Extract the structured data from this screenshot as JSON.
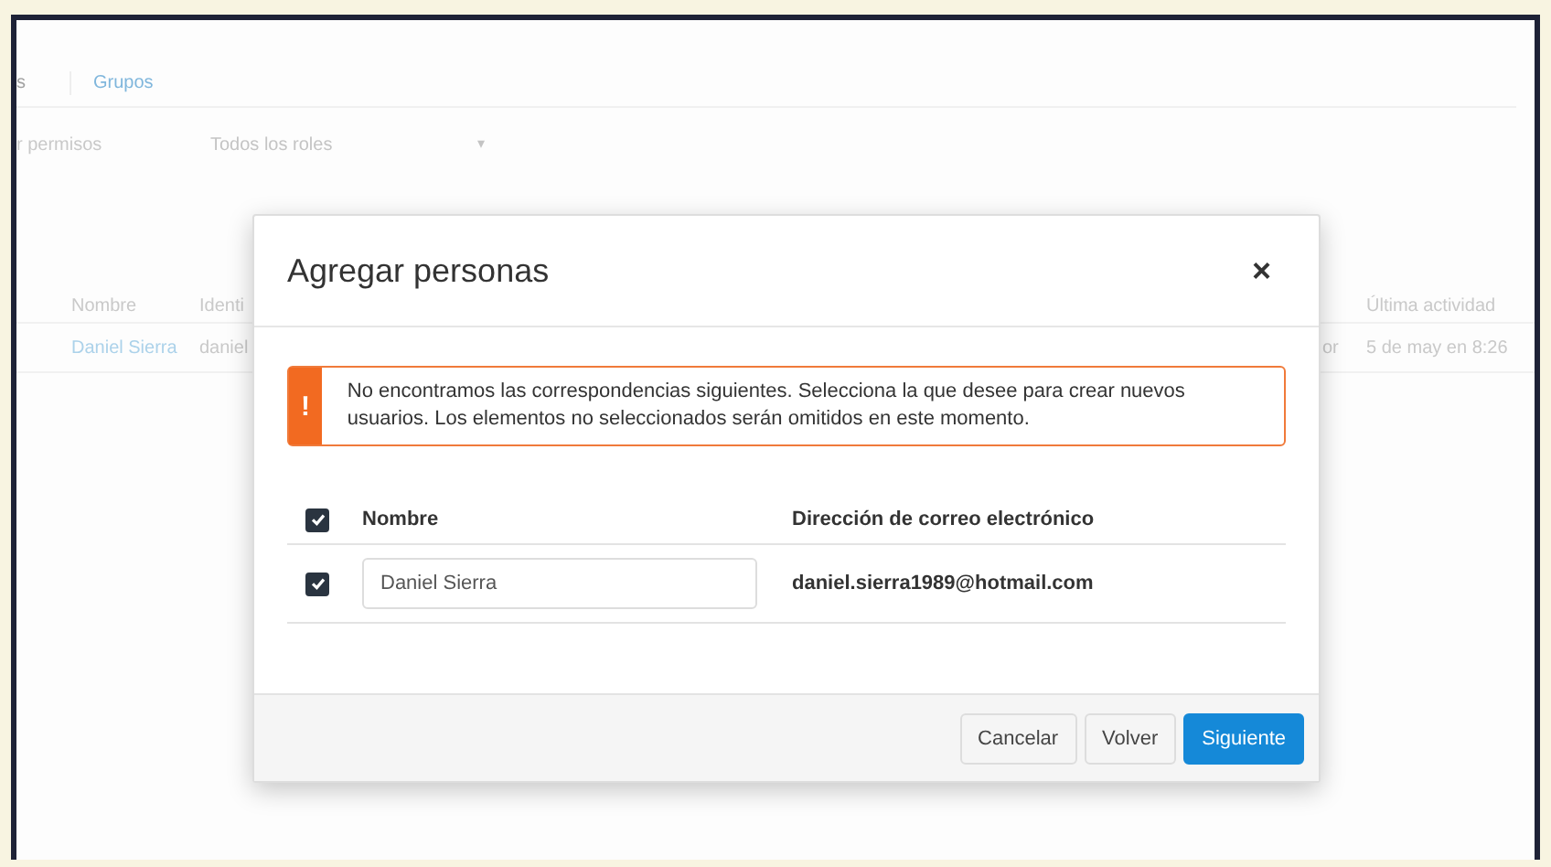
{
  "background": {
    "tabs": [
      {
        "label": "s",
        "selected": false
      },
      {
        "label": "Grupos",
        "selected": true
      }
    ],
    "filter_label": "r permisos",
    "role_dropdown": {
      "value": "Todos los roles",
      "caret": "▾"
    },
    "table": {
      "columns": [
        "Nombre",
        "Identi",
        "Última actividad"
      ],
      "rows": [
        {
          "name": "Daniel Sierra",
          "column_2": "daniel",
          "column_3": "or",
          "last_activity": "5 de may en 8:26"
        }
      ]
    }
  },
  "dialog": {
    "title": "Agregar personas",
    "close": "×",
    "alert": {
      "icon": "!",
      "message": "No encontramos las correspondencias siguientes. Selecciona la que desee para crear nuevos usuarios. Los elementos no seleccionados serán omitidos en este momento."
    },
    "select_all": {
      "checked": true
    },
    "columns": [
      "Nombre",
      "Dirección de correo electrónico"
    ],
    "rows": [
      {
        "checked": true,
        "name": "Daniel Sierra",
        "email": "daniel.sierra1989@hotmail.com"
      }
    ],
    "buttons": [
      {
        "label": "Cancelar",
        "kind": "secondary"
      },
      {
        "label": "Volver",
        "kind": "secondary"
      },
      {
        "label": "Siguiente",
        "kind": "primary"
      }
    ]
  }
}
